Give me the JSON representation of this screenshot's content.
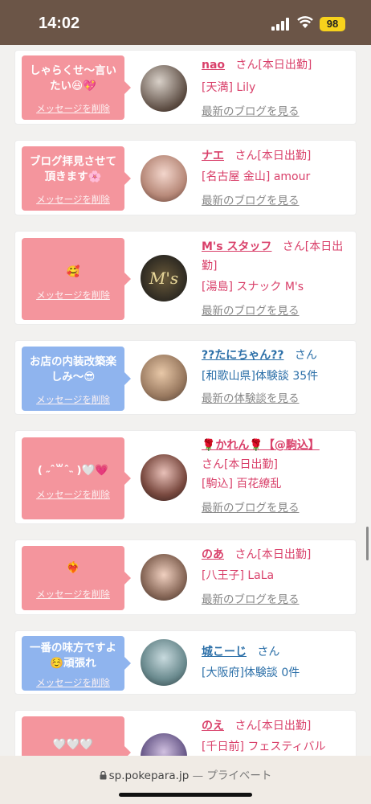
{
  "status": {
    "time": "14:02",
    "battery": "98"
  },
  "cards": [
    {
      "message": "しゃらくせ〜言いたい😆💖",
      "delete": "メッセージを削除",
      "name": "nao",
      "san": "さん",
      "status": "[本日出勤]",
      "store": "[天満] Lily",
      "link": "最新のブログを見る",
      "type": "pink"
    },
    {
      "message": "ブログ拝見させて頂きます🌸",
      "delete": "メッセージを削除",
      "name": "ナエ",
      "san": "さん",
      "status": "[本日出勤]",
      "store": "[名古屋 金山] amour",
      "link": "最新のブログを見る",
      "type": "pink"
    },
    {
      "message": "🥰",
      "delete": "メッセージを削除",
      "name": "M's スタッフ",
      "san": "さん",
      "status": "[本日出勤]",
      "store": "[湯島] スナック M's",
      "link": "最新のブログを見る",
      "type": "pink"
    },
    {
      "message": "お店の内装改築楽しみ〜😎",
      "delete": "メッセージを削除",
      "name": "??たにちゃん??",
      "san": "さん",
      "status": "",
      "store": "[和歌山県]体験談 35件",
      "link": "最新の体験談を見る",
      "type": "blue"
    },
    {
      "message": "( ˶ˆ꒳ˆ˵ )🤍💗",
      "delete": "メッセージを削除",
      "name": "🌹かれん🌹【@駒込】",
      "san": "さん",
      "status": "[本日出勤]",
      "store": "[駒込] 百花繚乱",
      "link": "最新のブログを見る",
      "type": "pink"
    },
    {
      "message": "❤️‍🔥",
      "delete": "メッセージを削除",
      "name": "のあ",
      "san": "さん",
      "status": "[本日出勤]",
      "store": "[八王子] LaLa",
      "link": "最新のブログを見る",
      "type": "pink"
    },
    {
      "message": "一番の味方ですよ☺️頑張れ",
      "delete": "メッセージを削除",
      "name": "城こーじ",
      "san": "さん",
      "status": "",
      "store": "[大阪府]体験談 0件",
      "link": "",
      "type": "blue"
    },
    {
      "message": "🤍🤍🤍",
      "delete": "",
      "name": "のえ",
      "san": "さん",
      "status": "[本日出勤]",
      "store": "[千日前] フェスティバル",
      "link": "",
      "type": "pink"
    }
  ],
  "browser": {
    "url": "sp.pokepara.jp",
    "private": "— プライベート"
  }
}
